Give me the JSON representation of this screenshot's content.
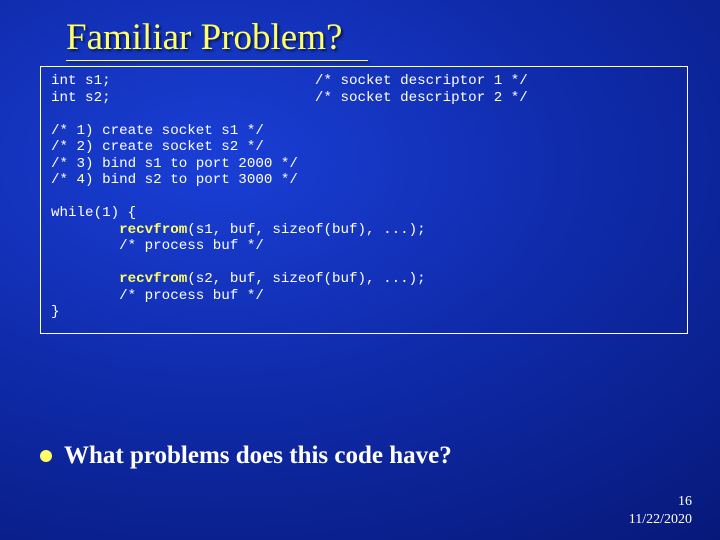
{
  "title": "Familiar Problem?",
  "code": {
    "l1": "int s1;                        /* socket descriptor 1 */",
    "l2": "int s2;                        /* socket descriptor 2 */",
    "blank1": "",
    "l3": "/* 1) create socket s1 */",
    "l4": "/* 2) create socket s2 */",
    "l5": "/* 3) bind s1 to port 2000 */",
    "l6": "/* 4) bind s2 to port 3000 */",
    "blank2": "",
    "l7": "while(1) {",
    "l8a": "        ",
    "kw1": "recvfrom",
    "l8b": "(s1, buf, sizeof(buf), ...);",
    "l9": "        /* process buf */",
    "blank3": "",
    "l10a": "        ",
    "kw2": "recvfrom",
    "l10b": "(s2, buf, sizeof(buf), ...);",
    "l11": "        /* process buf */",
    "l12": "}"
  },
  "bullet": "What problems does this code have?",
  "page_number": "16",
  "date": "11/22/2020"
}
